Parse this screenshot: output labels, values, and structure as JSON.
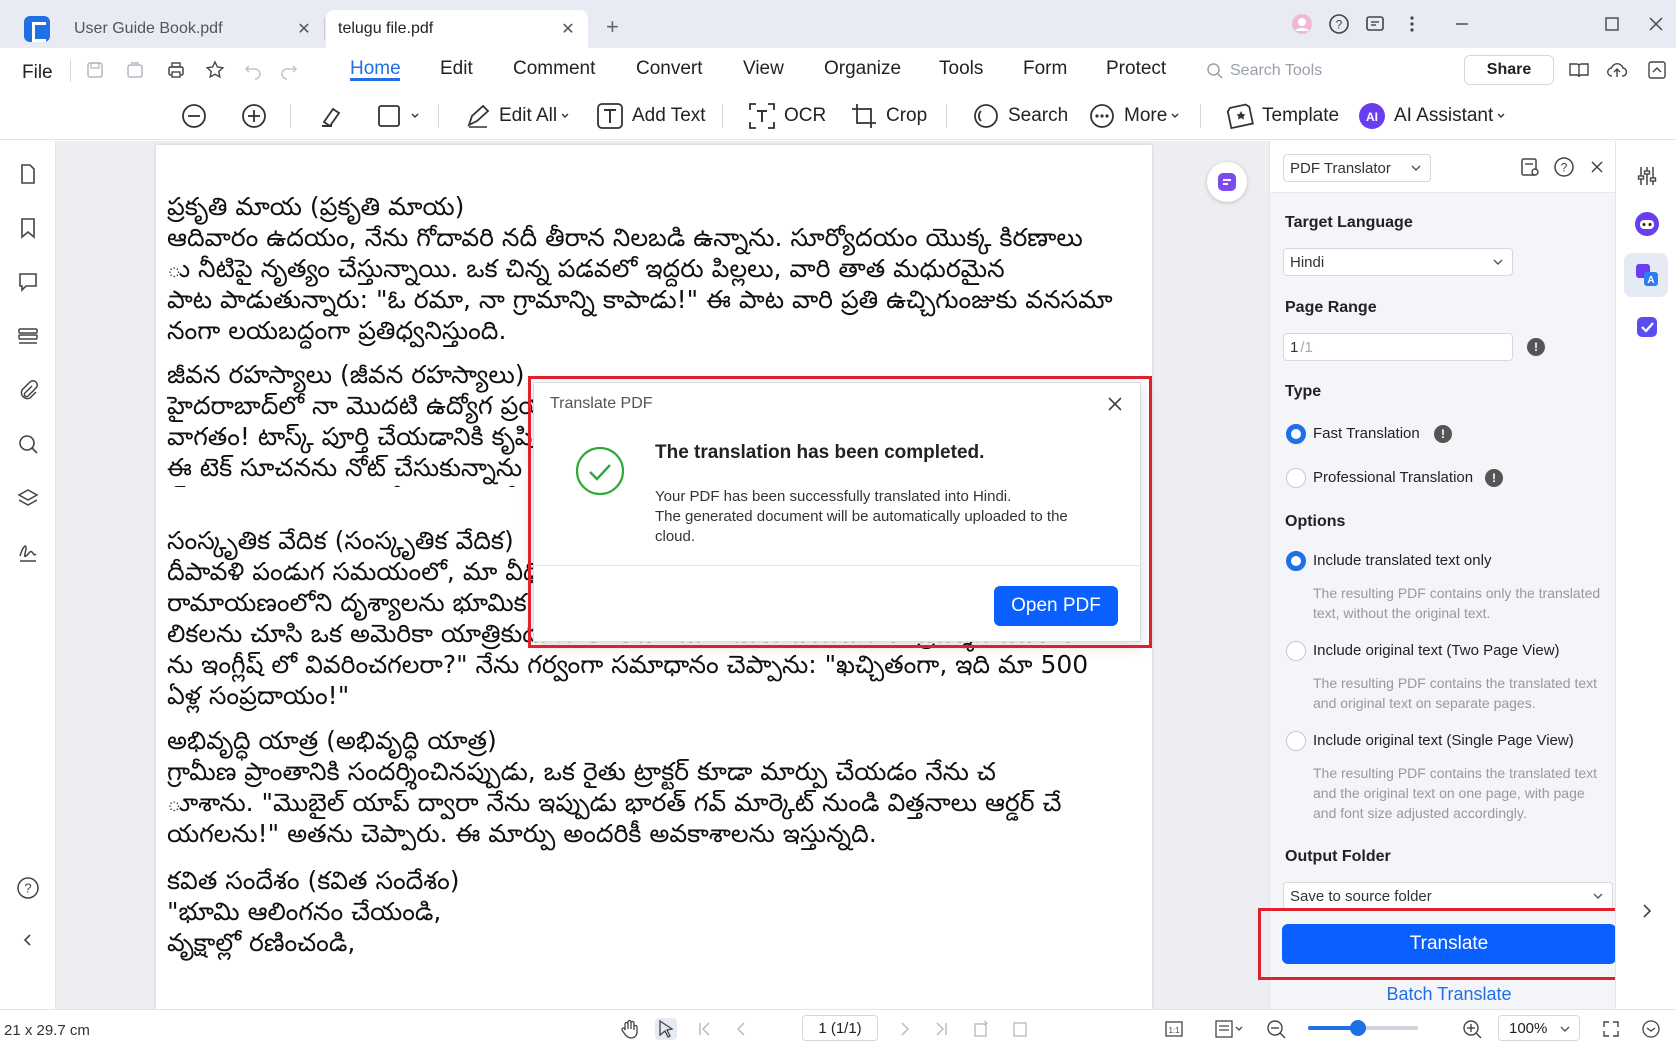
{
  "tabs": [
    {
      "label": "User Guide Book.pdf",
      "active": false
    },
    {
      "label": "telugu file.pdf",
      "active": true
    }
  ],
  "menu": {
    "file": "File",
    "items": [
      "Home",
      "Edit",
      "Comment",
      "Convert",
      "View",
      "Organize",
      "Tools",
      "Form",
      "Protect"
    ],
    "active": "Home",
    "search_placeholder": "Search Tools",
    "share": "Share"
  },
  "toolbar": {
    "edit_all": "Edit All",
    "add_text": "Add Text",
    "ocr": "OCR",
    "crop": "Crop",
    "search": "Search",
    "more": "More",
    "template": "Template",
    "ai_assistant": "AI Assistant"
  },
  "document": {
    "paragraphs": [
      "ప్రకృతి మాయ (ప్రకృతి మాయ)\nఆదివారం ఉదయం, నేను గోదావరి నదీ తీరాన నిలబడి ఉన్నాను. సూర్యోదయం యొక్క కిరణాలు\nు నీటిపై నృత్యం చేస్తున్నాయి. ఒక చిన్న పడవలో ఇద్దరు పిల్లలు, వారి తాత మధురమైన\nపాట పాడుతున్నారు: \"ఓ రమా, నా గ్రామాన్ని కాపాడు!\" ఈ పాట వారి ప్రతి ఉచ్చిగుంజుకు వనసమా\nనంగా లయబద్ధంగా ప్రతిధ్వనిస్తుంది.",
      "  జీవన రహస్యాలు (జీవన రహస్యాలు)\nహైదరాబాద్‌లో నా మొదటి ఉద్యోగ ప్రయాణం\nవాగతం! టాస్క్ పూర్తి చేయడానికి కృషి\nఈ టెక్ సూచనను నోట్ చేసుకున్నాను\nచ్ చూపించింది: \"ఇది రోజూ నా ఆరోగ్యం",
      "  సంస్కృతిక వేదిక (సంస్కృతిక వేదిక)\nదీపావళి పండుగ సమయంలో, మా వీధి\nరామాయణంలోని దృశ్యాలను భూమిక\nలికలను చూసి ఒక అమెరికా యాత్రికుడు నాతో అడిగాడు: \"మీరు దయచేసి ఈ ప్రదర్శన వివరాల\nను ఇంగ్లీష్ లో వివరించగలరా?\" నేను గర్వంగా సమాధానం చెప్పాను: \"ఖచ్చితంగా, ఇది మా 500\nఏళ్ల సంప్రదాయం!\"",
      "  అభివృద్ధి యాత్ర (అభివృద్ధి యాత్ర)\nగ్రామీణ ప్రాంతానికి సందర్శించినప్పుడు, ఒక రైతు ట్రాక్టర్ కూడా మార్పు చేయడం నేను చ\nూశాను. \"మొబైల్ యాప్ ద్వారా నేను ఇప్పుడు భారత్ గవ్ మార్కెట్ నుండి విత్తనాలు ఆర్డర్ చే\nయగలను!\" అతను చెప్పారు. ఈ మార్పు అందరికీ అవకాశాలను ఇస్తున్నది.",
      "  కవిత సందేశం (కవిత సందేశం)\n\"భూమి ఆలింగనం చేయండి,\nవృక్షాల్లో రణించండి,"
    ]
  },
  "dialog": {
    "title": "Translate PDF",
    "heading": "The translation has been completed.",
    "message_line1": "Your PDF has been successfully translated into Hindi.",
    "message_line2": "The generated document will be automatically uploaded to the cloud.",
    "open_pdf": "Open PDF"
  },
  "panel": {
    "mode": "PDF Translator",
    "target_language_label": "Target Language",
    "target_language": "Hindi",
    "page_range_label": "Page Range",
    "page_range_value": "1",
    "page_range_total": "/1",
    "type_label": "Type",
    "type_fast": "Fast Translation",
    "type_professional": "Professional Translation",
    "options_label": "Options",
    "opt1_label": "Include translated text only",
    "opt1_desc": "The resulting PDF contains only the translated text, without the original text.",
    "opt2_label": "Include original text (Two Page View)",
    "opt2_desc": "The resulting PDF contains the translated text and original text on separate pages.",
    "opt3_label": "Include original text (Single Page View)",
    "opt3_desc": "The resulting PDF contains the translated text and the original text on one page, with page and font size adjusted accordingly.",
    "output_folder_label": "Output Folder",
    "output_folder": "Save to source folder",
    "translate": "Translate",
    "batch_translate": "Batch Translate"
  },
  "status": {
    "page_size": "21 x 29.7 cm",
    "page_nav": "1 (1/1)",
    "zoom": "100%",
    "zoom_level": 0.45
  },
  "colors": {
    "accent": "#1f6fe5",
    "primary_button": "#0a5fff",
    "highlight_frame": "#e0212b",
    "success": "#2eaa3c"
  }
}
